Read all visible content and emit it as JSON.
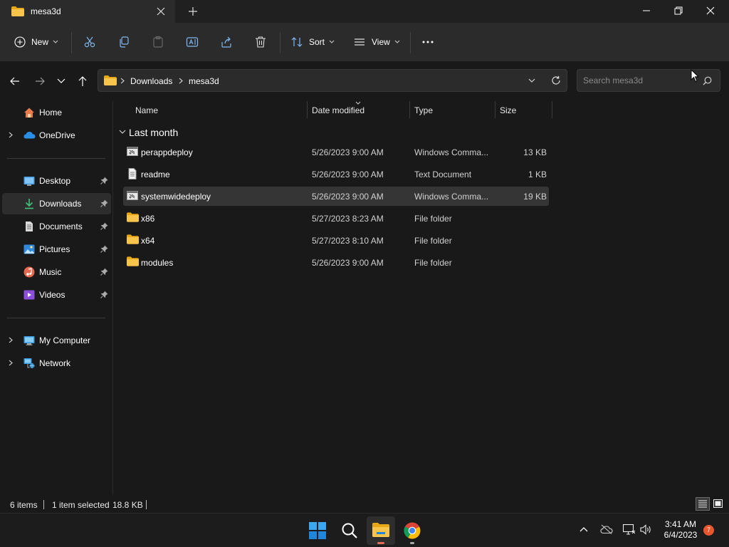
{
  "window": {
    "tab_title": "mesa3d",
    "folder_color": "#f8c54c",
    "accent": "#0078d4"
  },
  "toolbar": {
    "new_label": "New",
    "sort_label": "Sort",
    "view_label": "View",
    "icons": [
      "cut-icon",
      "copy-icon",
      "paste-icon",
      "rename-icon",
      "share-icon",
      "delete-icon",
      "more-icon"
    ]
  },
  "address": {
    "crumbs": [
      "Downloads",
      "mesa3d"
    ]
  },
  "search": {
    "placeholder": "Search mesa3d"
  },
  "navpane": {
    "home": "Home",
    "onedrive": "OneDrive",
    "quick_access": [
      {
        "label": "Desktop",
        "icon": "desktop-icon"
      },
      {
        "label": "Downloads",
        "icon": "download-icon",
        "selected": true
      },
      {
        "label": "Documents",
        "icon": "documents-icon"
      },
      {
        "label": "Pictures",
        "icon": "pictures-icon"
      },
      {
        "label": "Music",
        "icon": "music-icon"
      },
      {
        "label": "Videos",
        "icon": "videos-icon"
      }
    ],
    "my_computer": "My Computer",
    "network": "Network"
  },
  "files": {
    "columns": {
      "name": "Name",
      "date": "Date modified",
      "type": "Type",
      "size": "Size"
    },
    "group": "Last month",
    "rows": [
      {
        "name": "perappdeploy",
        "date": "5/26/2023 9:00 AM",
        "type": "Windows Comma...",
        "size": "13 KB",
        "icon": "batch-file-icon"
      },
      {
        "name": "readme",
        "date": "5/26/2023 9:00 AM",
        "type": "Text Document",
        "size": "1 KB",
        "icon": "text-file-icon"
      },
      {
        "name": "systemwidedeploy",
        "date": "5/26/2023 9:00 AM",
        "type": "Windows Comma...",
        "size": "19 KB",
        "icon": "batch-file-icon",
        "selected": true
      },
      {
        "name": "x86",
        "date": "5/27/2023 8:23 AM",
        "type": "File folder",
        "size": "",
        "icon": "folder-icon"
      },
      {
        "name": "x64",
        "date": "5/27/2023 8:10 AM",
        "type": "File folder",
        "size": "",
        "icon": "folder-icon"
      },
      {
        "name": "modules",
        "date": "5/26/2023 9:00 AM",
        "type": "File folder",
        "size": "",
        "icon": "folder-icon"
      }
    ]
  },
  "status": {
    "items": "6 items",
    "selected": "1 item selected",
    "selected_size": "18.8 KB"
  },
  "taskbar": {
    "time": "3:41 AM",
    "date": "6/4/2023",
    "notifications": "7",
    "badge_color": "#e8562e"
  }
}
